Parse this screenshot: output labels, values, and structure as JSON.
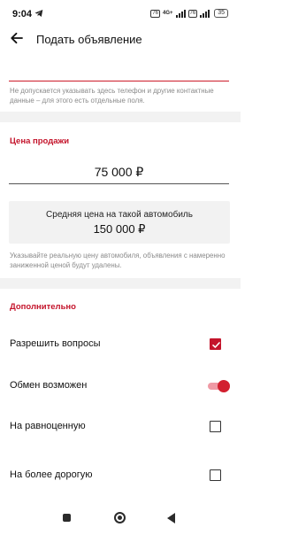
{
  "status_bar": {
    "time": "9:04",
    "telegram_icon": "telegram-icon",
    "box1": "76",
    "net_type": "4G+",
    "box2": "76",
    "battery": "35"
  },
  "topbar": {
    "back_icon": "arrow-left-icon",
    "title": "Подать объявление"
  },
  "description": {
    "value": "",
    "hint": "Не допускается указывать здесь телефон и другие контактные данные – для этого есть отдельные поля."
  },
  "price_section": {
    "title": "Цена продажи",
    "price": "75 000 ₽",
    "avg_label": "Средняя цена на такой автомобиль",
    "avg_value": "150 000 ₽",
    "hint": "Указывайте реальную цену автомобиля, объявления с намеренно заниженной ценой будут удалены."
  },
  "extra_section": {
    "title": "Дополнительно",
    "options": [
      {
        "label": "Разрешить вопросы",
        "control": "checkbox",
        "checked": true
      },
      {
        "label": "Обмен возможен",
        "control": "toggle",
        "checked": true
      },
      {
        "label": "На равноценную",
        "control": "checkbox",
        "checked": false
      },
      {
        "label": "На более дорогую",
        "control": "checkbox",
        "checked": false
      }
    ]
  },
  "colors": {
    "accent": "#c4142b",
    "toggle_track": "#ef9aa5",
    "hint_text": "#8a8a8a",
    "divider": "#f2f2f2"
  },
  "nav_bar": {
    "recent_icon": "square-recent-icon",
    "home_icon": "home-circle-icon",
    "back_icon": "triangle-back-icon"
  }
}
